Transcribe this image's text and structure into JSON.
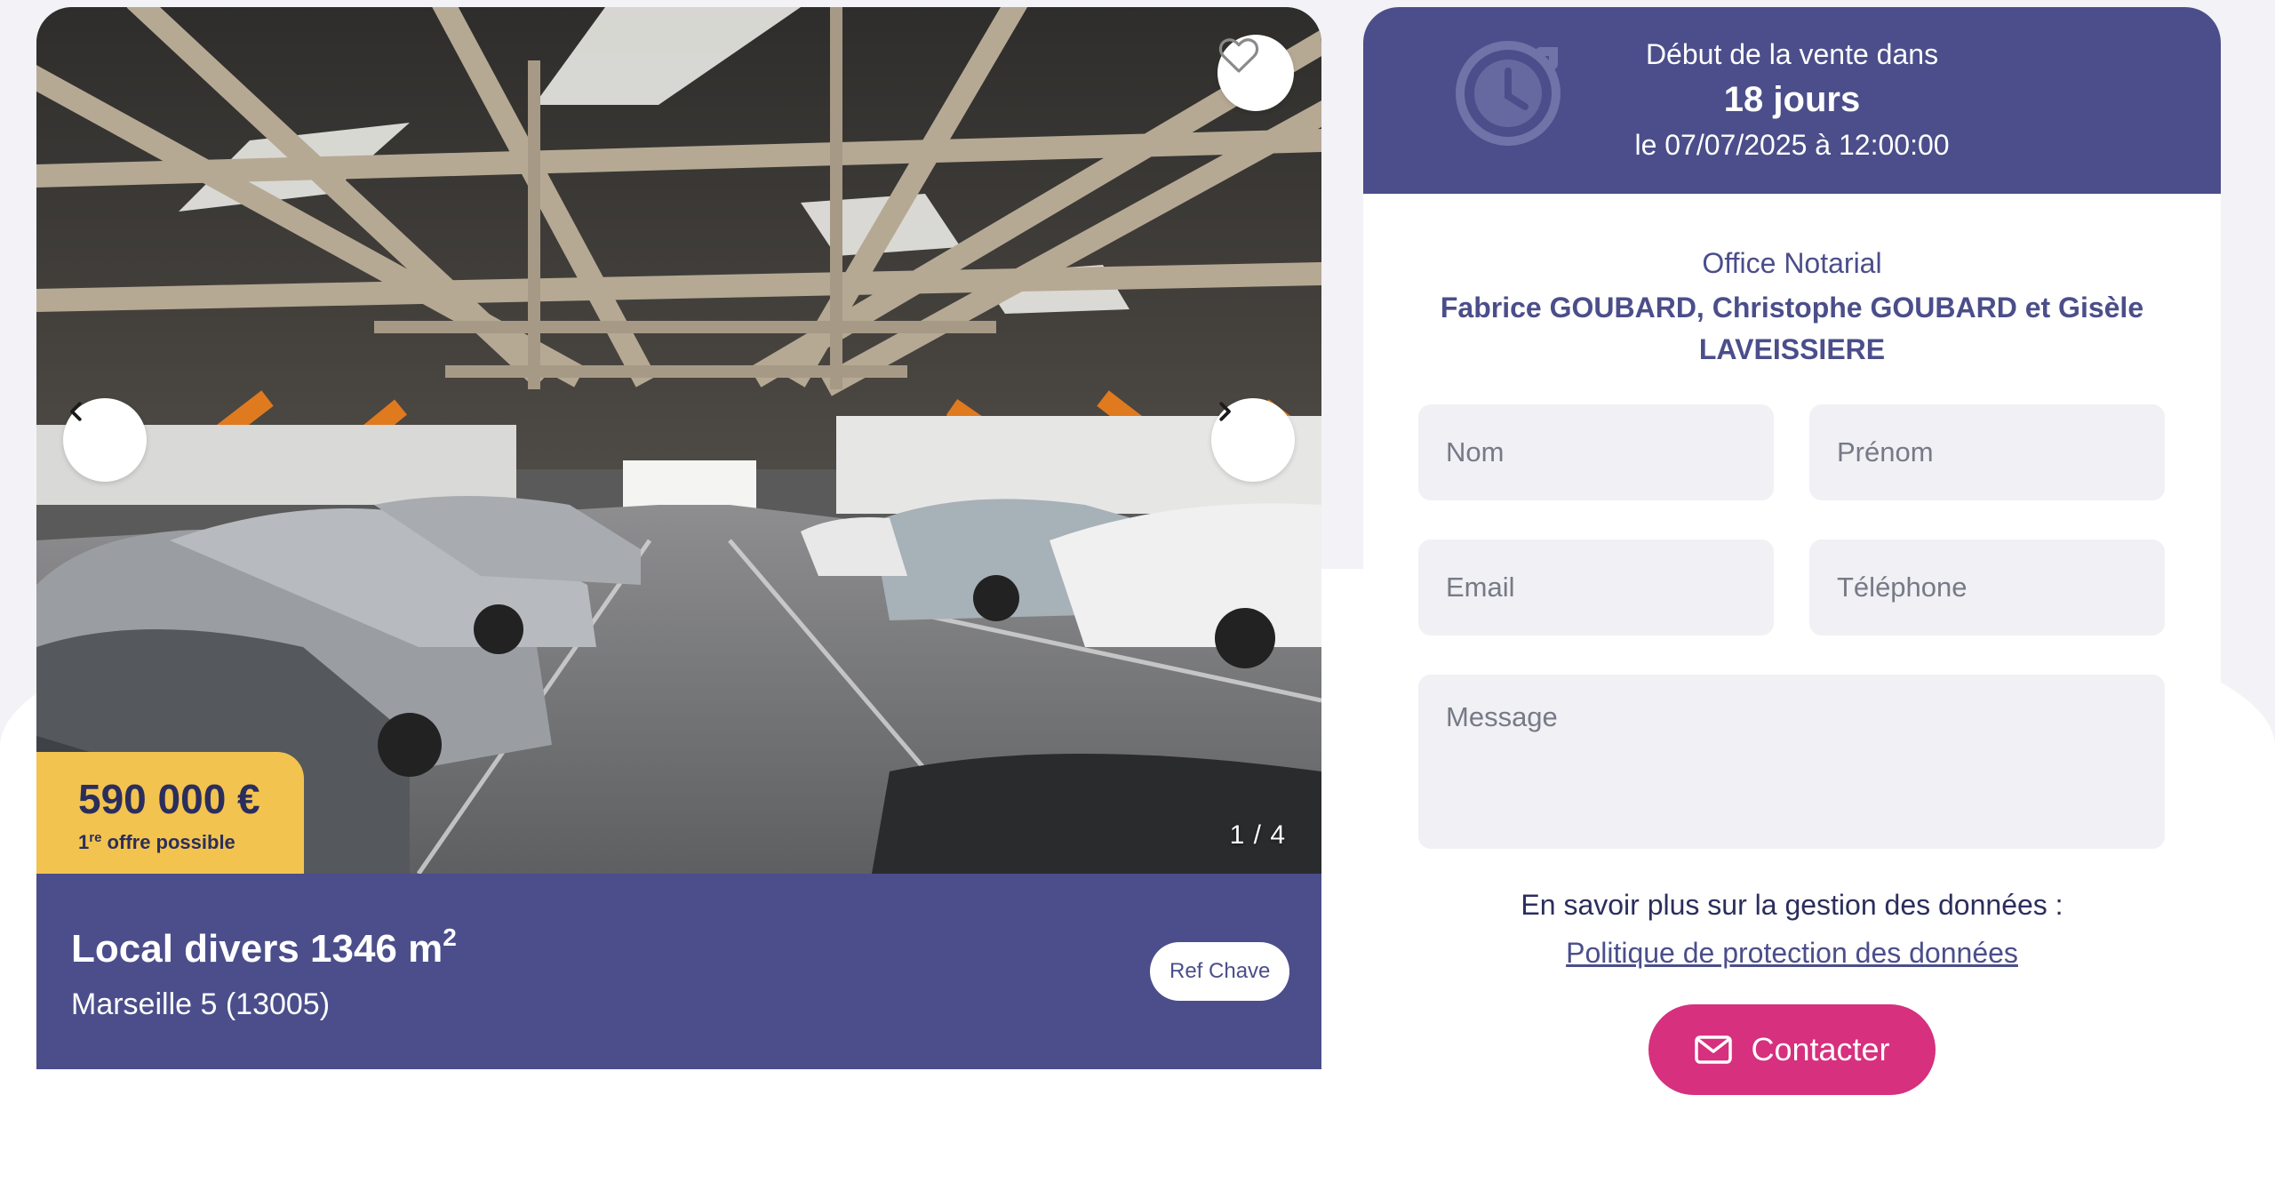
{
  "listing": {
    "favorite_icon": "heart-outline-icon",
    "prev_icon": "chevron-left-icon",
    "next_icon": "chevron-right-icon",
    "photo_counter": "1 / 4",
    "price": "590 000 €",
    "price_note_prefix": "1",
    "price_note_sup": "re",
    "price_note_suffix": " offre possible",
    "title": "Local divers 1346 m",
    "title_sup": "2",
    "location": "Marseille 5 (13005)",
    "ref_badge": "Ref Chave"
  },
  "sale": {
    "clock_icon": "clock-icon",
    "label": "Début de la vente dans",
    "days": "18 jours",
    "date": "le 07/07/2025 à 12:00:00"
  },
  "office": {
    "type": "Office Notarial",
    "name": "Fabrice GOUBARD, Christophe GOUBARD et Gisèle LAVEISSIERE"
  },
  "form": {
    "nom_placeholder": "Nom",
    "prenom_placeholder": "Prénom",
    "email_placeholder": "Email",
    "telephone_placeholder": "Téléphone",
    "message_placeholder": "Message",
    "privacy_text": "En savoir plus sur la gestion des données :",
    "privacy_link": "Politique de protection des données",
    "contact_label": "Contacter",
    "contact_icon": "mail-icon"
  },
  "colors": {
    "brand_purple": "#4b4e8a",
    "price_yellow": "#f2c34e",
    "contact_pink": "#d6307e"
  }
}
